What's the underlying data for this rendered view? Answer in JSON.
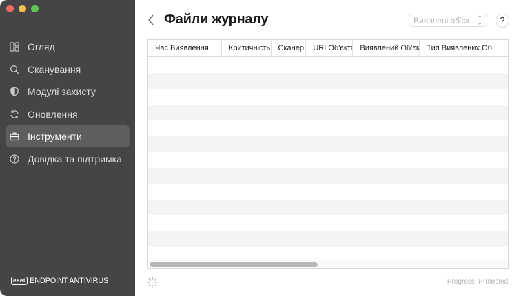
{
  "sidebar": {
    "items": [
      {
        "label": "Огляд",
        "icon": "dashboard-icon"
      },
      {
        "label": "Сканування",
        "icon": "search-icon"
      },
      {
        "label": "Модулі захисту",
        "icon": "shield-icon"
      },
      {
        "label": "Оновлення",
        "icon": "refresh-icon"
      },
      {
        "label": "Інструменти",
        "icon": "briefcase-icon",
        "active": true
      },
      {
        "label": "Довідка та підтримка",
        "icon": "help-circle-icon"
      }
    ],
    "brand": {
      "logo": "eset",
      "product": "ENDPOINT ANTIVIRUS"
    }
  },
  "header": {
    "title": "Файли журналу",
    "filter_value": "Виявлені об'єк...",
    "help_label": "?"
  },
  "table": {
    "columns": [
      "Час Виявлення",
      "Критичність",
      "Сканер",
      "URI Об'єкта",
      "Виявлений Об'єкт",
      "Тип Виявлених Об"
    ]
  },
  "footer": {
    "tagline": "Progress. Protected."
  },
  "colors": {
    "sidebar_bg": "#454547",
    "active_item_bg": "#5e5e61",
    "stripe": "#f4f4f4"
  }
}
